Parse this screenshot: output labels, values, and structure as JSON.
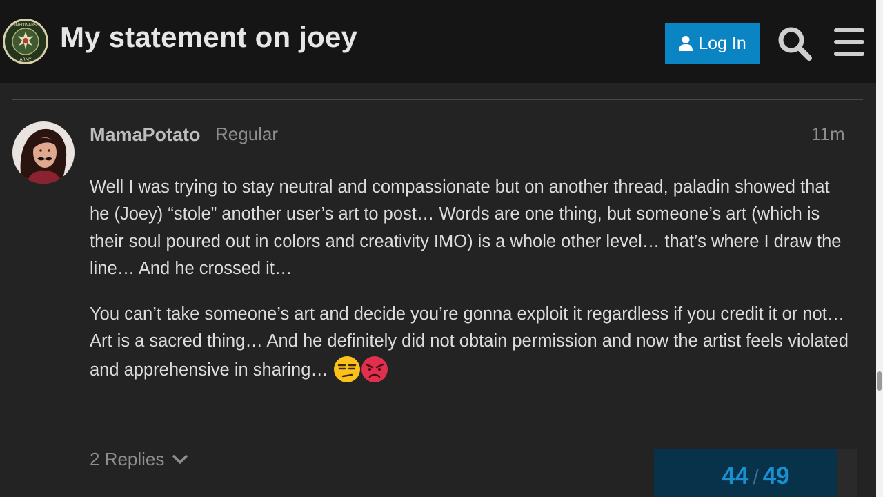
{
  "header": {
    "topic_title": "My statement on joey",
    "login_label": "Log In",
    "logo_icon": "army-seal-logo",
    "logo_text_top": "INFOWARS",
    "logo_text_bottom": "ARMY",
    "login_color": "#0b84c4"
  },
  "post": {
    "username": "MamaPotato",
    "user_title": "Regular",
    "date": "11m",
    "paragraph_1": "Well I was trying to stay neutral and compassionate but on another thread, paladin showed that he (Joey) “stole” another user’s art to post… Words are one thing, but someone’s art (which is their soul poured out in colors and creativity IMO) is a whole other level… that’s where I draw the line… And he crossed it…",
    "paragraph_2": "You can’t take someone’s art and decide you’re gonna exploit it regardless if you credit it or not… Art is a sacred thing… And he definitely did not obtain permission and now the artist feels violated and apprehensive in sharing… ",
    "emojis": [
      "unamused-emoji",
      "rage-emoji"
    ],
    "replies_label": "2 Replies"
  },
  "progress": {
    "current": "44",
    "separator": "/",
    "total": "49",
    "fill_fraction": 0.9,
    "accent": "#1a8fd0"
  }
}
